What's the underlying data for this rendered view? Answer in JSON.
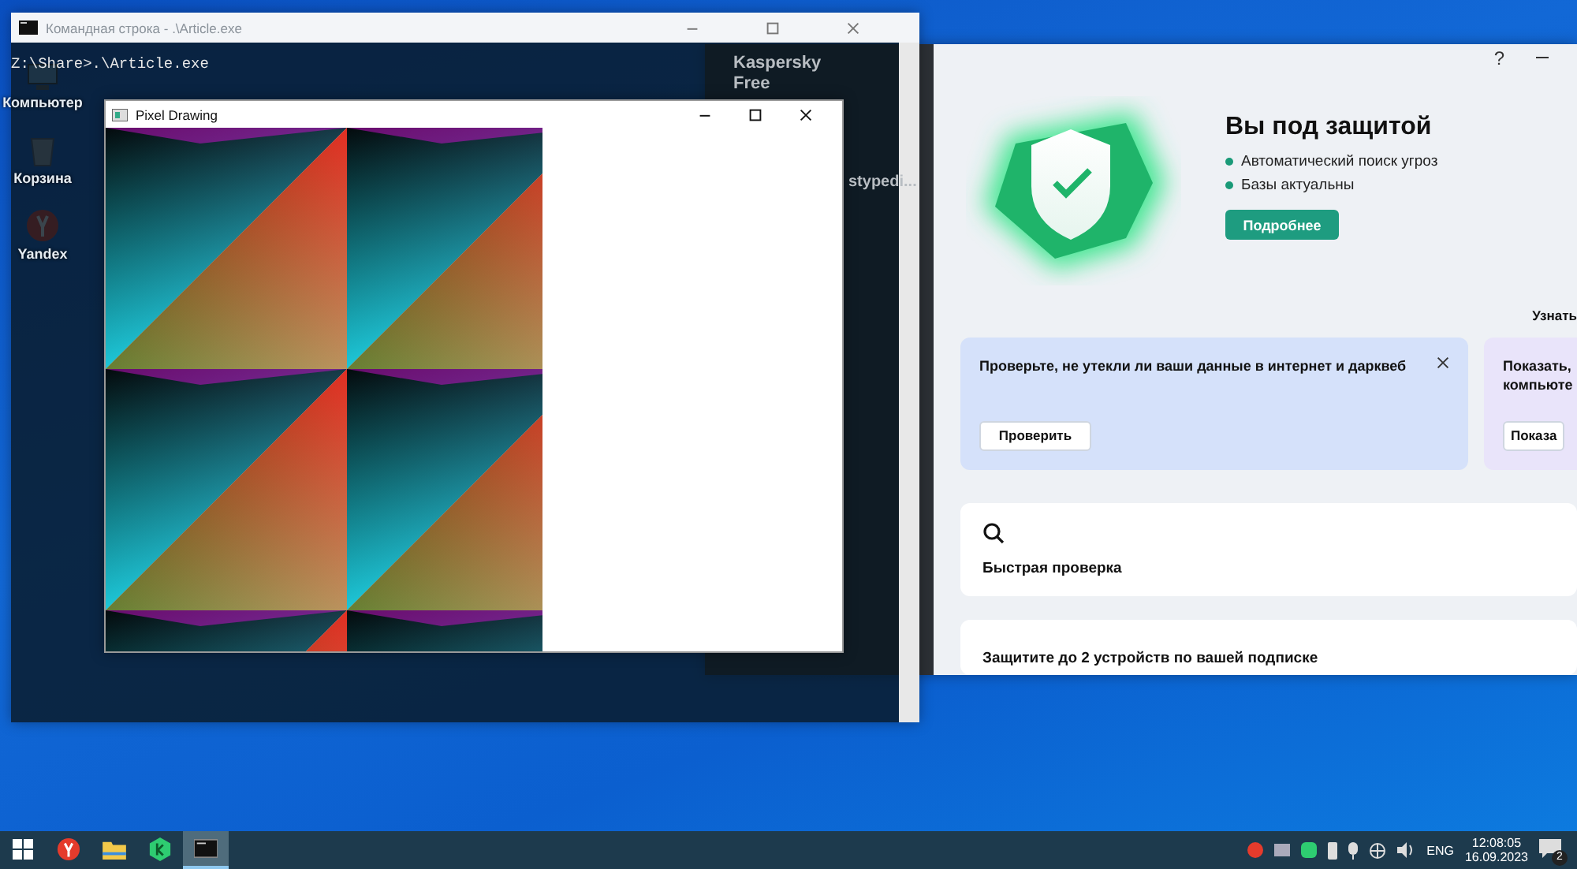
{
  "desktop": {
    "icons": [
      {
        "kind": "computer",
        "label": "Компьютер"
      },
      {
        "kind": "bin",
        "label": "Корзина"
      },
      {
        "kind": "yandex",
        "label": "Yandex"
      }
    ]
  },
  "kaspersky": {
    "sidebar": {
      "title": "Kaspersky Free",
      "item": "stypedi..."
    },
    "help": "?",
    "status": {
      "title": "Вы под защитой",
      "bullets": [
        "Автоматический поиск угроз",
        "Базы актуальны"
      ],
      "button": "Подробнее"
    },
    "link": "Узнать",
    "cards": [
      {
        "lines": [
          "Проверьте, не утекли ли ваши данные в интернет и дарквеб"
        ],
        "button": "Проверить",
        "color": "#d5e1fa",
        "closable": true
      },
      {
        "lines": [
          "Показать,",
          "компьюте"
        ],
        "button": "Показа",
        "color": "#e9e4fa",
        "closable": false
      }
    ],
    "quick_scan": "Быстрая проверка",
    "subscription": "Защитите до 2 устройств по вашей подписке"
  },
  "console": {
    "title": "Командная строка - .\\Article.exe",
    "lines": [
      "Z:\\Share>.\\Article.exe"
    ]
  },
  "pixel_window": {
    "title": "Pixel Drawing"
  },
  "taskbar": {
    "apps": [
      {
        "kind": "yandex",
        "active": false
      },
      {
        "kind": "folder",
        "active": false
      },
      {
        "kind": "kaspersky",
        "active": false
      },
      {
        "kind": "console",
        "active": true
      }
    ],
    "language": "ENG",
    "time": "12:08:05",
    "date": "16.09.2023",
    "notifications": "2"
  }
}
